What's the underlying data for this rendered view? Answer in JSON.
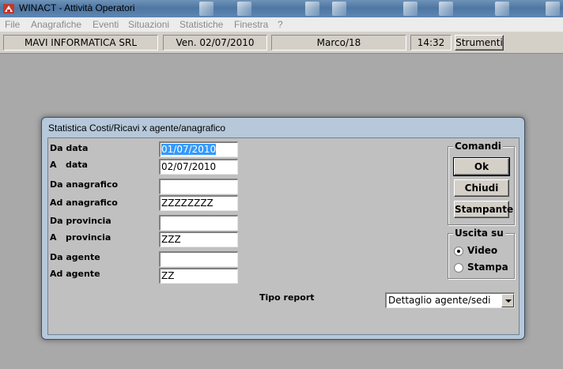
{
  "window": {
    "title": "WINACT - Attività Operatori"
  },
  "menu": [
    "File",
    "Anagrafiche",
    "Eventi",
    "Situazioni",
    "Statistiche",
    "Finestra",
    "?"
  ],
  "infobar": {
    "company": "MAVI INFORMATICA SRL",
    "date": "Ven. 02/07/2010",
    "period": "Marco/18",
    "time": "14:32",
    "tools_button": "Strumenti"
  },
  "dialog": {
    "title": "Statistica Costi/Ricavi x agente/anagrafico",
    "fields": [
      {
        "label": "Da data",
        "value": "01/07/2010",
        "selected": true
      },
      {
        "label": "A   data",
        "value": "02/07/2010"
      },
      {
        "label": "Da anagrafico",
        "value": ""
      },
      {
        "label": "Ad anagrafico",
        "value": "ZZZZZZZZ"
      },
      {
        "label": "Da provincia",
        "value": ""
      },
      {
        "label": "A   provincia",
        "value": "ZZZ"
      },
      {
        "label": "Da agente",
        "value": ""
      },
      {
        "label": "Ad agente",
        "value": "ZZ"
      }
    ],
    "commands": {
      "title": "Comandi",
      "ok_label": "Ok",
      "close_label": "Chiudi",
      "print_label": "Stampante"
    },
    "output": {
      "title": "Uscita su",
      "options": [
        "Video",
        "Stampa"
      ],
      "selected": "Video"
    },
    "report_type": {
      "label": "Tipo report",
      "value": "Dettaglio agente/sedi"
    }
  }
}
